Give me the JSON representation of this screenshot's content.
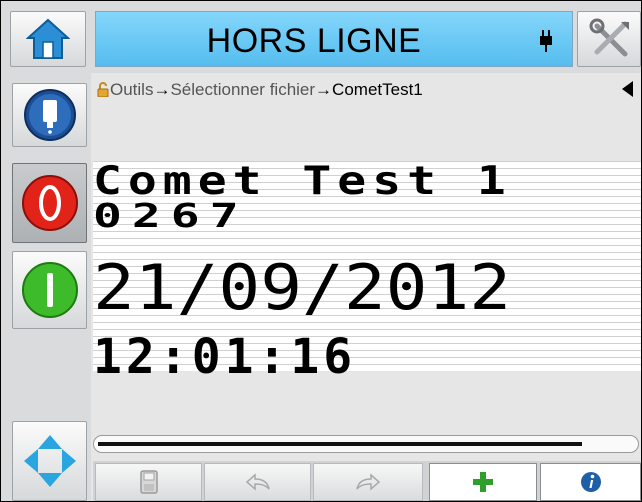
{
  "header": {
    "status": "HORS LIGNE",
    "icons": {
      "home": "home-icon",
      "connection": "plug-icon",
      "tools": "tools-icon"
    }
  },
  "sidebar": {
    "buttons": [
      {
        "name": "ink-cartridge",
        "icon": "ink-cartridge-icon"
      },
      {
        "name": "stop-jet",
        "icon": "stop-icon",
        "color": "#e2231a"
      },
      {
        "name": "start-jet",
        "icon": "start-icon",
        "color": "#3dbb2a"
      },
      {
        "name": "navigate",
        "icon": "four-way-arrows-icon",
        "color": "#29a6df"
      }
    ]
  },
  "breadcrumb": {
    "items": [
      "Outils",
      "Sélectionner fichier",
      "CometTest1"
    ],
    "separator": "→"
  },
  "message": {
    "lines": [
      "Comet Test 1",
      "0267",
      "21/09/2012",
      "12:01:16"
    ]
  },
  "toolbar": {
    "buttons": [
      {
        "name": "save",
        "icon": "save-icon",
        "enabled": false
      },
      {
        "name": "undo",
        "icon": "undo-icon",
        "enabled": false
      },
      {
        "name": "redo",
        "icon": "redo-icon",
        "enabled": false
      },
      {
        "name": "add",
        "icon": "plus-icon",
        "enabled": true,
        "color": "#2f9e2a"
      },
      {
        "name": "info",
        "icon": "info-icon",
        "enabled": true,
        "color": "#1f5fa8"
      }
    ]
  },
  "colors": {
    "status_bar": "#55bdee",
    "accent_blue": "#1f5fa8"
  }
}
